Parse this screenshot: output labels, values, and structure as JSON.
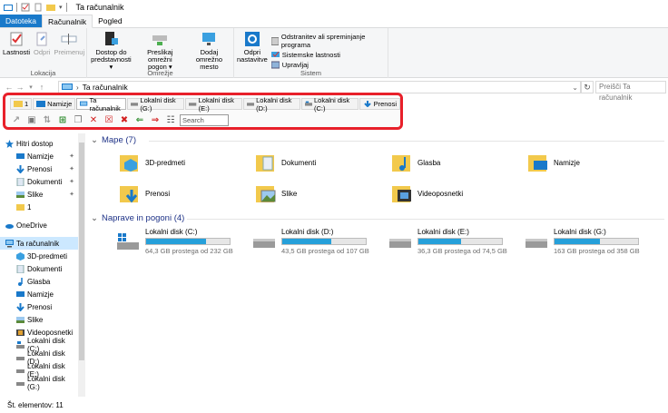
{
  "window": {
    "title": "Ta računalnik"
  },
  "ribbon_tabs": [
    "Datoteka",
    "Računalnik",
    "Pogled"
  ],
  "ribbon": {
    "lokacija": {
      "label": "Lokacija",
      "buttons": [
        "Lastnosti",
        "Odpri",
        "Preimenuj"
      ]
    },
    "omrezje": {
      "label": "Omrežje",
      "buttons": [
        {
          "l1": "Dostop do",
          "l2": "predstavnosti ▾"
        },
        {
          "l1": "Preslikaj omrežni",
          "l2": "pogon ▾"
        },
        {
          "l1": "Dodaj omrežno",
          "l2": "mesto"
        }
      ]
    },
    "sistem": {
      "label": "Sistem",
      "big": {
        "l1": "Odpri",
        "l2": "nastavitve"
      },
      "small": [
        "Odstranitev ali spreminjanje programa",
        "Sistemske lastnosti",
        "Upravljaj"
      ]
    }
  },
  "address": {
    "path": "Ta računalnik",
    "search_placeholder": "Preišči Ta računalnik"
  },
  "quick_tabs": [
    "1",
    "Namizje",
    "Ta računalnik",
    "Lokalni disk (G:)",
    "Lokalni disk (E:)",
    "Lokalni disk (D:)",
    "Lokalni disk (C:)",
    "Prenosi"
  ],
  "quick_toolbar": {
    "search_placeholder": "Search"
  },
  "nav": [
    {
      "label": "Hitri dostop",
      "pinned": false
    },
    {
      "label": "Namizje",
      "pinned": true
    },
    {
      "label": "Prenosi",
      "pinned": true
    },
    {
      "label": "Dokumenti",
      "pinned": true
    },
    {
      "label": "Slike",
      "pinned": true
    },
    {
      "label": "1",
      "pinned": false
    },
    {
      "label": "OneDrive",
      "pinned": false
    },
    {
      "label": "Ta računalnik",
      "pinned": false
    },
    {
      "label": "3D-predmeti",
      "pinned": false
    },
    {
      "label": "Dokumenti",
      "pinned": false
    },
    {
      "label": "Glasba",
      "pinned": false
    },
    {
      "label": "Namizje",
      "pinned": false
    },
    {
      "label": "Prenosi",
      "pinned": false
    },
    {
      "label": "Slike",
      "pinned": false
    },
    {
      "label": "Videoposnetki",
      "pinned": false
    },
    {
      "label": "Lokalni disk (C:)",
      "pinned": false
    },
    {
      "label": "Lokalni disk (D:)",
      "pinned": false
    },
    {
      "label": "Lokalni disk (E:)",
      "pinned": false
    },
    {
      "label": "Lokalni disk (G:)",
      "pinned": false
    }
  ],
  "sections": {
    "folders": "Mape (7)",
    "drives": "Naprave in pogoni (4)"
  },
  "folders": [
    "3D-predmeti",
    "Dokumenti",
    "Glasba",
    "Namizje",
    "Prenosi",
    "Slike",
    "Videoposnetki"
  ],
  "drives": [
    {
      "name": "Lokalni disk (C:)",
      "free": "64,3 GB prostega od 232 GB",
      "used_fraction": 0.72
    },
    {
      "name": "Lokalni disk (D:)",
      "free": "43,5 GB prostega od 107 GB",
      "used_fraction": 0.59
    },
    {
      "name": "Lokalni disk (E:)",
      "free": "36,3 GB prostega od 74,5 GB",
      "used_fraction": 0.51
    },
    {
      "name": "Lokalni disk (G:)",
      "free": "163 GB prostega od 358 GB",
      "used_fraction": 0.54
    }
  ],
  "status": {
    "items": "Št. elementov: 11"
  },
  "colors": {
    "accent": "#1979ca",
    "highlight": "#e8202a",
    "drive_bar": "#26a0da",
    "selected": "#cce8ff"
  }
}
